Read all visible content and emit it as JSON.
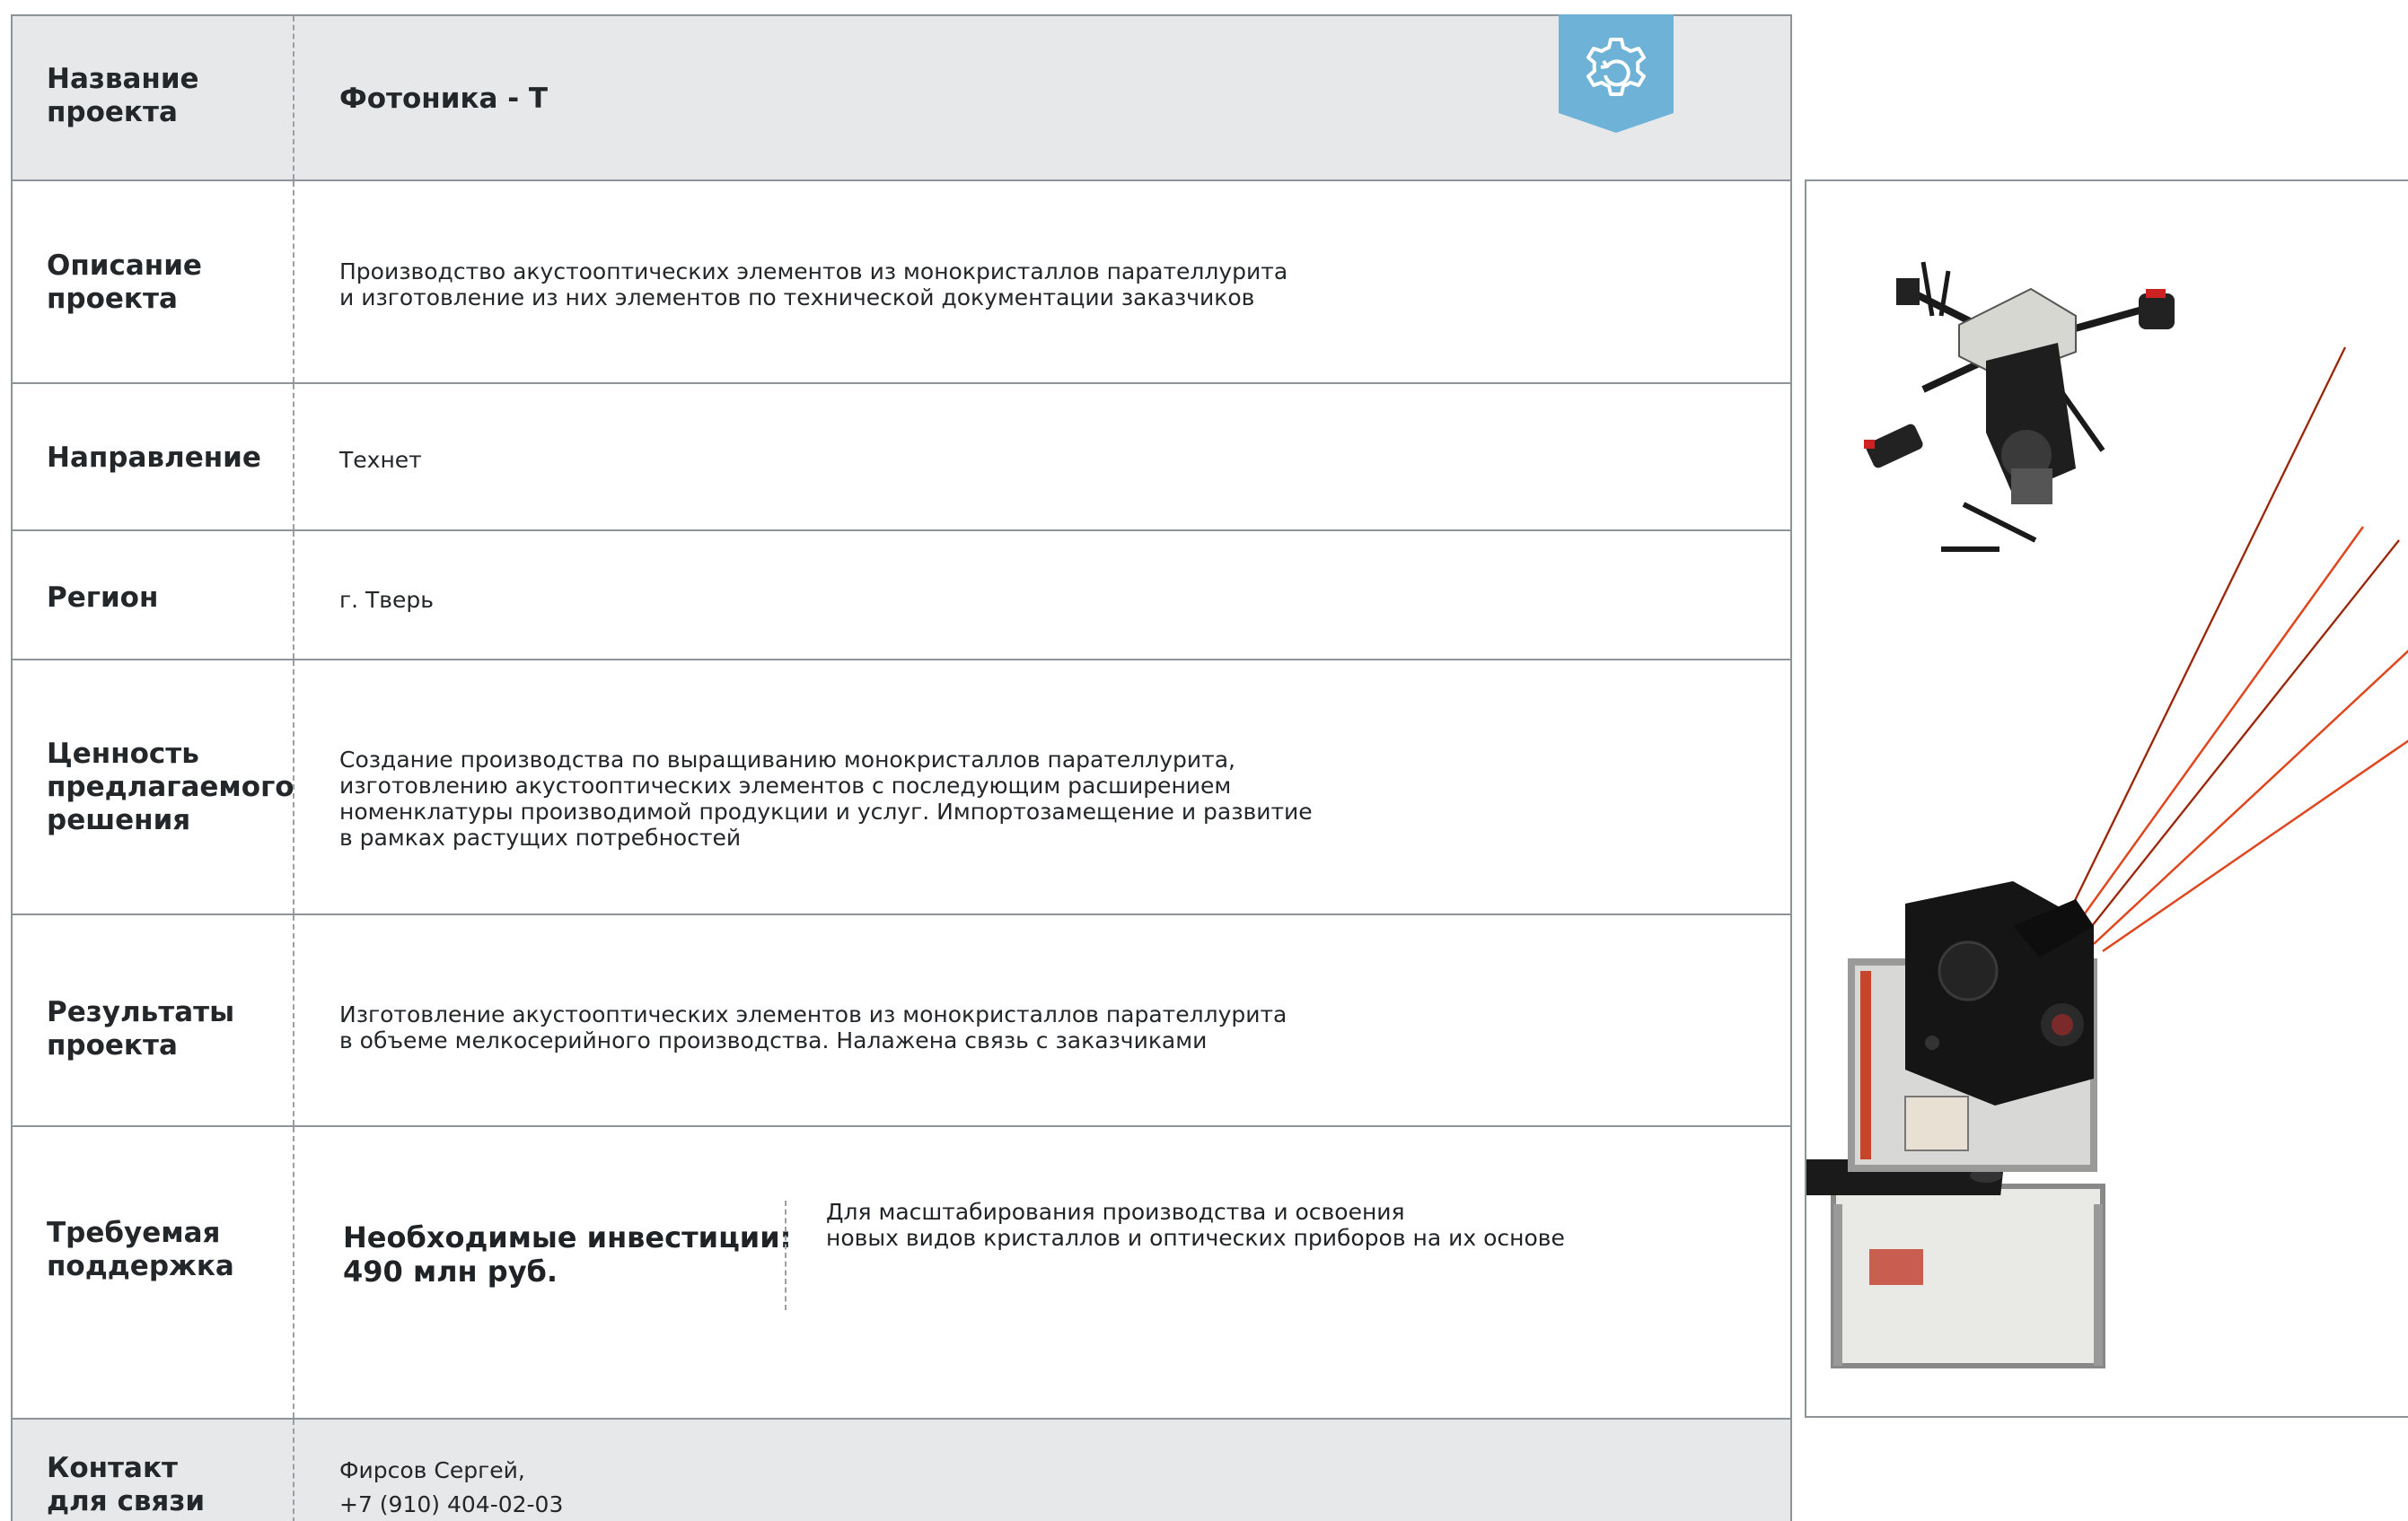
{
  "rows": {
    "name": {
      "label": "Название\nпроекта",
      "value": "Фотоника - Т"
    },
    "description": {
      "label": "Описание\nпроекта",
      "value": "Производство акустооптических элементов из монокристаллов парателлурита\nи изготовление из них элементов по технической документации заказчиков"
    },
    "direction": {
      "label": "Направление",
      "value": "Технет"
    },
    "region": {
      "label": "Регион",
      "value": "г. Тверь"
    },
    "value_prop": {
      "label": "Ценность\nпредлагаемого\nрешения",
      "value": "Создание производства по выращиванию монокристаллов парателлурита,\nизготовлению акустооптических элементов с последующим расширением\nноменклатуры производимой продукции и услуг. Импортозамещение и развитие\nв рамках растущих потребностей"
    },
    "results": {
      "label": "Результаты\nпроекта",
      "value": "Изготовление акустооптических элементов из монокристаллов парателлурита\nв объеме мелкосерийного производства. Налажена связь с заказчиками"
    },
    "support": {
      "label": "Требуемая\nподдержка",
      "investment": "Необходимые инвестиции:\n490 млн руб.",
      "note": "Для масштабирования производства и освоения\nновых видов кристаллов и оптических приборов на их основе"
    },
    "contact": {
      "label": "Контакт\nдля связи",
      "value": "Фирсов Сергей,\n+7 (910) 404-02-03"
    }
  },
  "icons": {
    "badge": "gear-icon",
    "photo": "drone-and-laser-device-photo"
  },
  "colors": {
    "badge": "#6fb2d8",
    "row_gray": "#e7e8ea",
    "border": "#8e9398",
    "laser": "#e0461e"
  }
}
